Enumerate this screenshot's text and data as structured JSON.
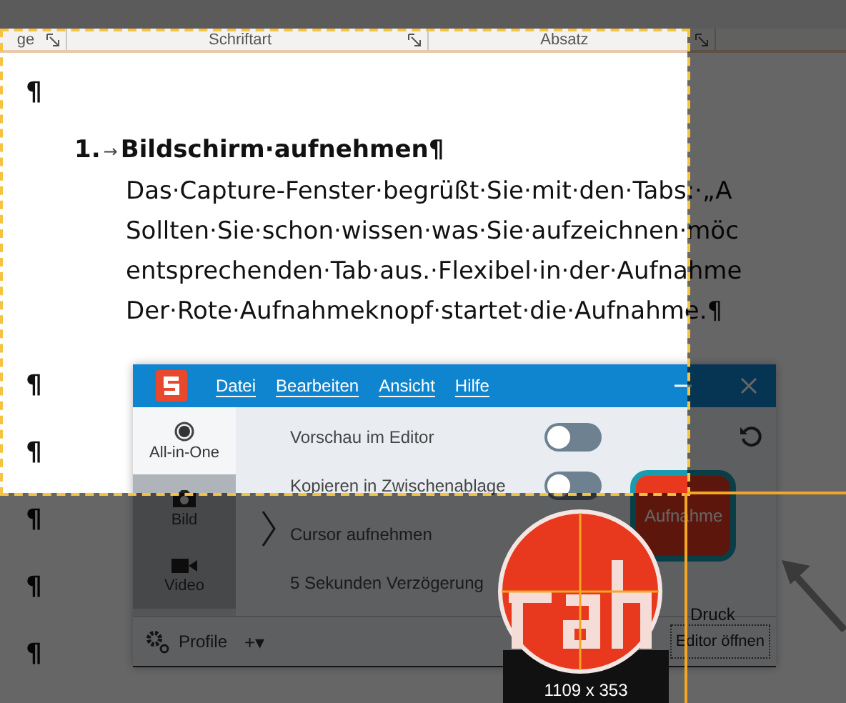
{
  "ribbon": {
    "groups": [
      {
        "label": "ge"
      },
      {
        "label": "Schriftart"
      },
      {
        "label": "Absatz"
      }
    ]
  },
  "document": {
    "lead_mark": "¶",
    "heading": {
      "number": "1.",
      "arrow": "→",
      "text": "Bildschirm·aufnehmen¶"
    },
    "body": [
      "Das·Capture-Fenster·begrüßt·Sie·mit·den·Tabs:·„A",
      "Sollten·Sie·schon·wissen·was·Sie·aufzeichnen·möc",
      "entsprechenden·Tab·aus.·Flexibel·in·der·Aufnahme",
      "Der·Rote·Aufnahmeknopf·startet·die·Aufnahme.¶"
    ],
    "trailing_marks": [
      "¶",
      "¶",
      "¶",
      "¶",
      "¶"
    ]
  },
  "capture_window": {
    "menu": [
      "Datei",
      "Bearbeiten",
      "Ansicht",
      "Hilfe"
    ],
    "modes": [
      {
        "label": "All-in-One",
        "kind": "radio",
        "selected": true
      },
      {
        "label": "Bild",
        "kind": "camera",
        "selected": false
      },
      {
        "label": "Video",
        "kind": "video",
        "selected": false
      }
    ],
    "options": [
      {
        "label": "Vorschau im Editor",
        "kind": "toggle",
        "on": false
      },
      {
        "label": "Kopieren in Zwischenablage",
        "kind": "toggle",
        "on": false
      },
      {
        "label": "Cursor aufnehmen",
        "kind": "plain"
      },
      {
        "label": "5 Sekunden Verzögerung",
        "kind": "plain"
      }
    ],
    "capture_button": "Aufnahme",
    "print_label": "Druck",
    "profile_label": "Profile",
    "add_label": "+▾",
    "editor_button": "Editor öffnen"
  },
  "magnifier": {
    "dimensions": "1109 x 353"
  }
}
